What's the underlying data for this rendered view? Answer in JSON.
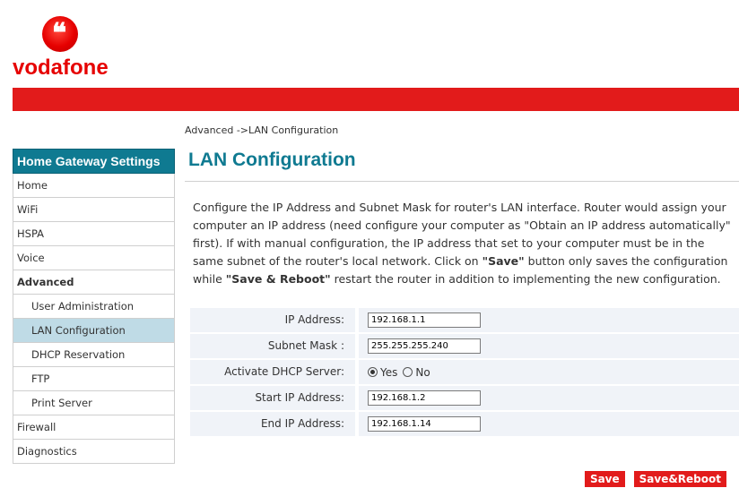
{
  "brand": {
    "name": "vodafone",
    "color": "#e60000"
  },
  "breadcrumb": "Advanced ->LAN Configuration",
  "sidebar": {
    "header": "Home Gateway Settings",
    "items": [
      {
        "label": "Home"
      },
      {
        "label": "WiFi"
      },
      {
        "label": "HSPA"
      },
      {
        "label": "Voice"
      },
      {
        "label": "Advanced"
      },
      {
        "label": "User Administration"
      },
      {
        "label": "LAN Configuration"
      },
      {
        "label": "DHCP Reservation"
      },
      {
        "label": "FTP"
      },
      {
        "label": "Print Server"
      },
      {
        "label": "Firewall"
      },
      {
        "label": "Diagnostics"
      }
    ]
  },
  "main": {
    "title": "LAN Configuration",
    "description": {
      "part1": "Configure the IP Address and Subnet Mask for router's LAN interface. Router would assign your computer an IP address (need configure your computer as \"Obtain an IP address automatically\" first). If with manual configuration, the IP address that set to your computer must be in the same subnet of the router's local network. Click on ",
      "save_bold": "\"Save\"",
      "part2": " button only saves the configuration while ",
      "save_reboot_bold": "\"Save & Reboot\"",
      "part3": " restart the router in addition to implementing the new configuration."
    },
    "form": {
      "ip_address": {
        "label": "IP Address:",
        "value": "192.168.1.1"
      },
      "subnet_mask": {
        "label": "Subnet Mask :",
        "value": "255.255.255.240"
      },
      "dhcp": {
        "label": "Activate DHCP Server:",
        "yes": "Yes",
        "no": "No",
        "selected": "Yes"
      },
      "start_ip": {
        "label": "Start IP Address:",
        "value": "192.168.1.2"
      },
      "end_ip": {
        "label": "End IP Address:",
        "value": "192.168.1.14"
      }
    },
    "buttons": {
      "save": "Save",
      "save_reboot": "Save&Reboot"
    }
  },
  "colors": {
    "accent": "#0f7a91",
    "red": "#e21b1b",
    "active_nav": "#bfdbe6"
  }
}
